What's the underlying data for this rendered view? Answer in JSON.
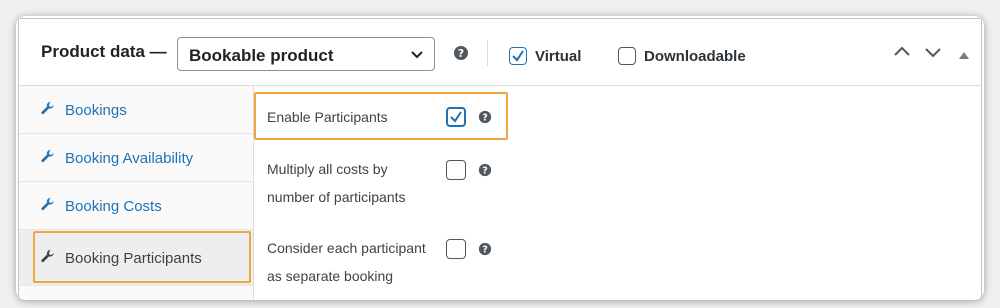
{
  "header": {
    "title": "Product data —",
    "product_type": "Bookable product",
    "virtual_label": "Virtual",
    "virtual_checked": true,
    "downloadable_label": "Downloadable",
    "downloadable_checked": false
  },
  "sidebar": {
    "items": [
      {
        "label": "Bookings",
        "icon": "wrench-icon",
        "active": false
      },
      {
        "label": "Booking Availability",
        "icon": "wrench-icon",
        "active": false
      },
      {
        "label": "Booking Costs",
        "icon": "wrench-icon",
        "active": false
      },
      {
        "label": "Booking Participants",
        "icon": "wrench-icon",
        "active": true
      }
    ]
  },
  "fields": [
    {
      "label": "Enable Participants",
      "checked": true
    },
    {
      "label_line1": "Multiply all costs by",
      "label_line2": "number of participants",
      "checked": false
    },
    {
      "label_line1": "Consider each participant",
      "label_line2": "as separate booking",
      "checked": false
    }
  ],
  "colors": {
    "accent": "#2271b1",
    "highlight": "#f0a640",
    "link": "#2271b1"
  }
}
